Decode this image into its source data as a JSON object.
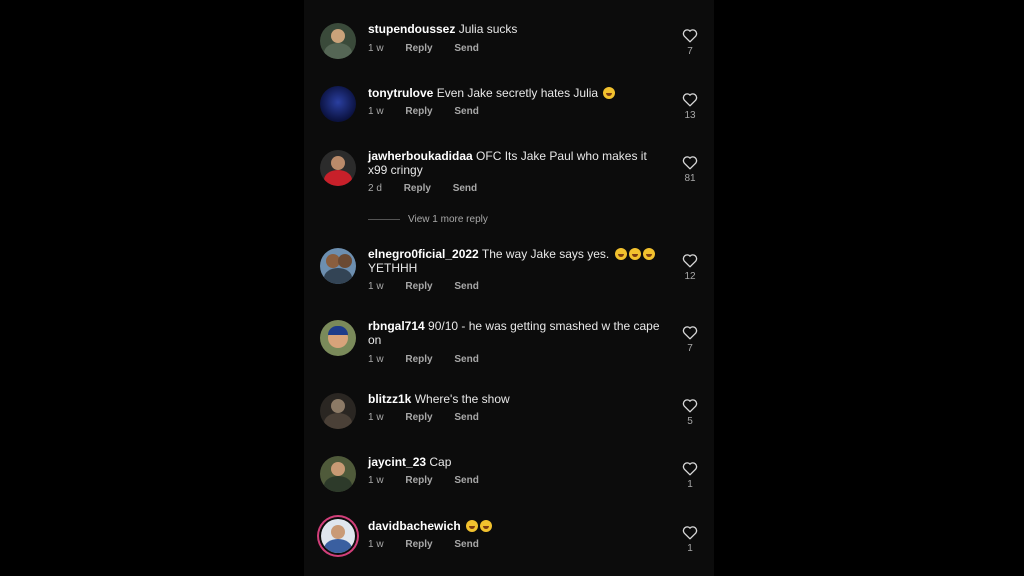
{
  "comments": [
    {
      "username": "stupendoussez",
      "text": "Julia sucks",
      "time": "1 w",
      "reply": "Reply",
      "send": "Send",
      "likes": "7",
      "emojis": 0
    },
    {
      "username": "tonytrulove",
      "text": "Even Jake secretly hates Julia",
      "time": "1 w",
      "reply": "Reply",
      "send": "Send",
      "likes": "13",
      "emojis": 1
    },
    {
      "username": "jawherboukadidaa",
      "text": "OFC Its Jake Paul who makes it x99 cringy",
      "time": "2 d",
      "reply": "Reply",
      "send": "Send",
      "likes": "81",
      "emojis": 0
    },
    {
      "username": "elnegro0ficial_2022",
      "text": "The way Jake says yes.",
      "text2": "YETHHH",
      "time": "1 w",
      "reply": "Reply",
      "send": "Send",
      "likes": "12",
      "emojis": 3
    },
    {
      "username": "rbngal714",
      "text": "90/10 - he was getting smashed w the cape on",
      "time": "1 w",
      "reply": "Reply",
      "send": "Send",
      "likes": "7",
      "emojis": 0
    },
    {
      "username": "blitzz1k",
      "text": "Where's the show",
      "time": "1 w",
      "reply": "Reply",
      "send": "Send",
      "likes": "5",
      "emojis": 0
    },
    {
      "username": "jaycint_23",
      "text": "Cap",
      "time": "1 w",
      "reply": "Reply",
      "send": "Send",
      "likes": "1",
      "emojis": 0
    },
    {
      "username": "davidbachewich",
      "text": "",
      "time": "1 w",
      "reply": "Reply",
      "send": "Send",
      "likes": "1",
      "emojis": 2
    }
  ],
  "view_more_reply": "View 1 more reply",
  "icons": {
    "like": "heart-outline-icon",
    "emoji": "laughing-emoji-icon"
  },
  "colors": {
    "background": "#000000",
    "panel": "#0c0c0c",
    "meta_text": "#a8a8a8",
    "story_ring": "#d23f7a"
  }
}
